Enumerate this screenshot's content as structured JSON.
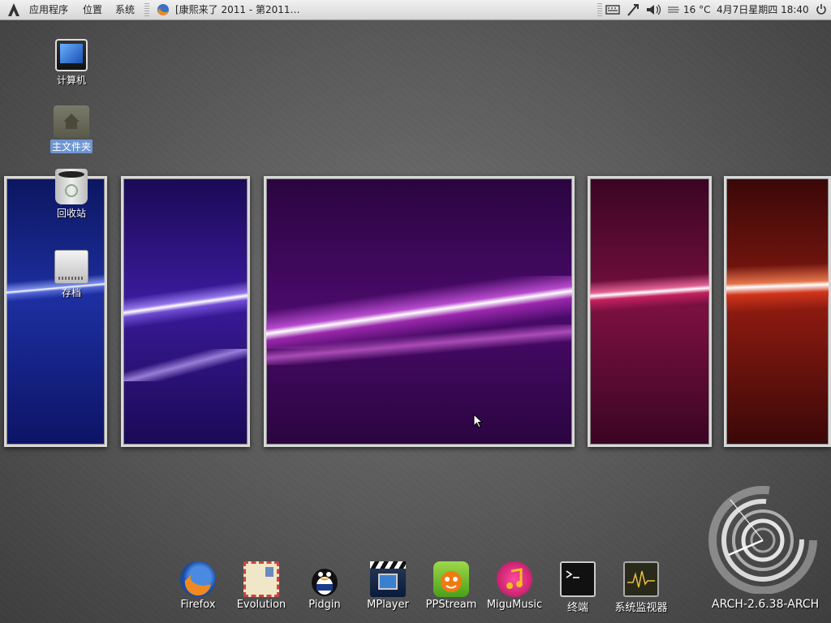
{
  "panel": {
    "menus": [
      "应用程序",
      "位置",
      "系统"
    ],
    "task_title": "[康熙来了 2011 - 第2011…",
    "temperature": "16 °C",
    "datetime": "4月7日星期四 18:40"
  },
  "desktop_icons": [
    {
      "label": "计算机"
    },
    {
      "label": "主文件夹"
    },
    {
      "label": "回收站"
    },
    {
      "label": "存档"
    }
  ],
  "dock": [
    {
      "label": "Firefox",
      "icon": "firefox-icon"
    },
    {
      "label": "Evolution",
      "icon": "evolution-icon"
    },
    {
      "label": "Pidgin",
      "icon": "pidgin-icon"
    },
    {
      "label": "MPlayer",
      "icon": "mplayer-icon"
    },
    {
      "label": "PPStream",
      "icon": "ppstream-icon"
    },
    {
      "label": "MiguMusic",
      "icon": "migumusic-icon"
    },
    {
      "label": "终端",
      "icon": "terminal-icon"
    },
    {
      "label": "系统监视器",
      "icon": "system-monitor-icon"
    }
  ],
  "widget": {
    "kernel": "ARCH-2.6.38-ARCH"
  },
  "colors": {
    "panel_bg": "#e6e6e6",
    "selection": "#6f96d0",
    "pane_blue": "#1a2a8a",
    "pane_violet": "#3a0f6a",
    "pane_purple": "#4a0a4a",
    "pane_crimson": "#6a0a2a",
    "pane_red": "#5a1010"
  }
}
